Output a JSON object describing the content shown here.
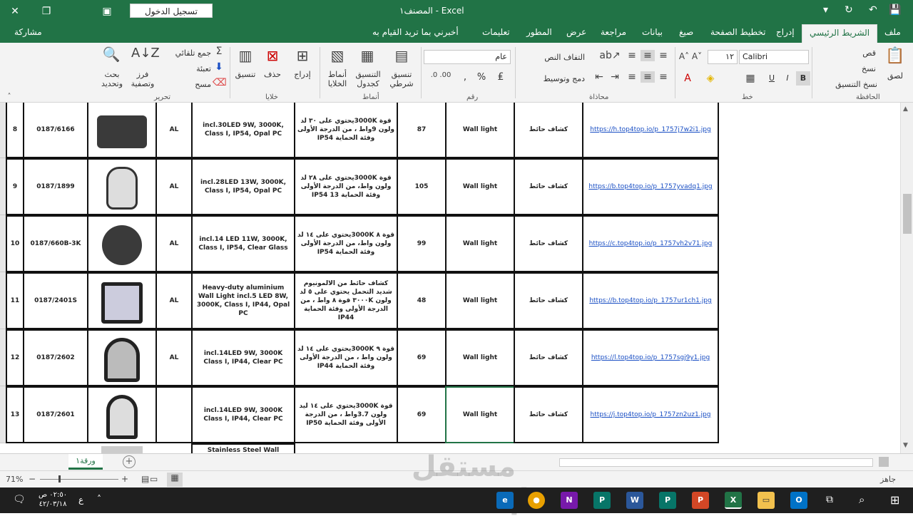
{
  "title_bar": {
    "title": "المصنف١  -  Excel",
    "signin_label": "تسجيل الدخول"
  },
  "tabs": {
    "file": "ملف",
    "home": "الشريط الرئيسي",
    "insert": "إدراج",
    "page_layout": "تخطيط الصفحة",
    "formulas": "صيغ",
    "data": "بيانات",
    "review": "مراجعة",
    "view": "عرض",
    "developer": "المطور",
    "help": "تعليمات",
    "tell_me": "أخبرني بما تريد القيام به",
    "share": "مشاركة"
  },
  "ribbon": {
    "paste": "لصق",
    "cut": "قص",
    "copy": "نسخ",
    "format_painter": "نسخ التنسيق",
    "clipboard": "الحافظة",
    "font_name": "Calibri",
    "font_size": "١٢",
    "bold": "B",
    "italic": "I",
    "underline": "U",
    "font_group": "خط",
    "wrap_text": "التفاف النص",
    "merge_center": "دمج وتوسيط",
    "alignment_group": "محاذاة",
    "number_format": "عام",
    "percent": "%",
    "number_group": "رقم",
    "conditional_formatting": "تنسيق شرطي",
    "format_as_table": "التنسيق كجدول",
    "cell_styles": "أنماط الخلايا",
    "styles_group": "أنماط",
    "insert_btn": "إدراج",
    "delete_btn": "حذف",
    "format_btn": "تنسيق",
    "cells_group": "خلايا",
    "autosum": "جمع تلقائي",
    "fill": "تعبئة",
    "clear": "مسح",
    "sort_filter": "فرز وتصفية",
    "find_select": "بحث وتحديد",
    "editing_group": "تحرير"
  },
  "rows": [
    {
      "num": "8",
      "code": "0187/6166",
      "mat": "AL",
      "desc_en": "incl.30LED 9W, 3000K, Class I, IP54, Opal PC",
      "desc_ar": "قوة 3000Kيحتوي على ٣٠ لد ولون 9واط ، من الدرجة الأولى وفئة الحماية IP54",
      "price": "87",
      "type_en": "Wall light",
      "type_ar": "كشاف حائط",
      "link": "https://h.top4top.io/p_1757j7w2i1.jpg"
    },
    {
      "num": "9",
      "code": "0187/1899",
      "mat": "AL",
      "desc_en": "incl.28LED 13W, 3000K, Class I, IP54, Opal PC",
      "desc_ar": "قوة 3000Kيحتوي على ٢٨ لد ولون واط، من الدرجة الأولى وفئة الحماية 13 IP54",
      "price": "105",
      "type_en": "Wall light",
      "type_ar": "كشاف حائط",
      "link": "https://b.top4top.io/p_1757yvadq1.jpg"
    },
    {
      "num": "10",
      "code": "0187/660B-3K",
      "mat": "AL",
      "desc_en": "incl.14 LED 11W, 3000K, Class I, IP54, Clear Glass",
      "desc_ar": "قوة ٨ 3000Kيحتوي على ١٤ لد ولون واط، من الدرجة الأولى وفئة الحماية IP54",
      "price": "99",
      "type_en": "Wall light",
      "type_ar": "كشاف حائط",
      "link": "https://c.top4top.io/p_1757vh2v71.jpg"
    },
    {
      "num": "11",
      "code": "0187/2401S",
      "mat": "AL",
      "desc_en": "Heavy-duty aluminium Wall Light incl.5 LED 8W, 3000K, Class I, IP44, Opal PC",
      "desc_ar": "كشاف حائط من الالمونيوم شديد التحمل يحتوي على ٥ لد ولون ٣٠٠٠K قوة ٨ واط ، من الدرجة الأولى وفئة الحماية IP44",
      "price": "48",
      "type_en": "Wall light",
      "type_ar": "كشاف حائط",
      "link": "https://b.top4top.io/p_1757ur1ch1.jpg"
    },
    {
      "num": "12",
      "code": "0187/2602",
      "mat": "AL",
      "desc_en": "incl.14LED 9W, 3000K Class I, IP44, Clear PC",
      "desc_ar": "قوة ٩ 3000Kيحتوي على ١٤ لد ولون واط ، من الدرجة الأولى وفئة الحماية IP44",
      "price": "69",
      "type_en": "Wall light",
      "type_ar": "كشاف حائط",
      "link": "https://l.top4top.io/p_1757sgj9y1.jpg"
    },
    {
      "num": "13",
      "code": "0187/2601",
      "mat": "",
      "desc_en": "incl.14LED 9W, 3000K Class I, IP44, Clear PC",
      "desc_ar": "قوة 3000Kيحتوي على ١٤ ليد ولون 3.7واط ، من الدرجة الأولى وفئة الحماية IP50",
      "price": "69",
      "type_en": "Wall light",
      "type_ar": "كشاف حائط",
      "link": "https://j.top4top.io/p_1757zn2uz1.jpg"
    }
  ],
  "next_row_partial": "Stainless Steel Wall Lantern",
  "sheet_tab": "ورقة١",
  "status": {
    "ready": "جاهز",
    "zoom": "71%"
  },
  "taskbar": {
    "time": "٠٢:٥٠ ص",
    "date": "٤٢/٠٣/١٨",
    "lang": "ع"
  },
  "watermark": "مستقل mostaql.com",
  "colors": {
    "excel_green": "#217346",
    "link_blue": "#1a4fc4"
  }
}
